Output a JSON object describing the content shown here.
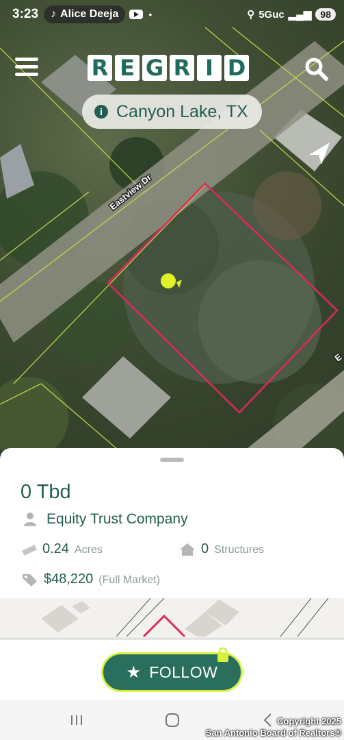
{
  "status_bar": {
    "time": "3:23",
    "notification": "Alice Deeja",
    "network": "5Guc",
    "battery": "98"
  },
  "header": {
    "logo_letters": [
      "R",
      "E",
      "G",
      "R",
      "I",
      "D"
    ]
  },
  "location": {
    "label": "Canyon Lake, TX"
  },
  "map": {
    "street_label": "Eastview Dr",
    "street_label_2": "E"
  },
  "parcel": {
    "title": "0 Tbd",
    "owner": "Equity Trust Company",
    "acres_value": "0.24",
    "acres_unit": "Acres",
    "structures_value": "0",
    "structures_unit": "Structures",
    "price_value": "$48,220",
    "price_note": "(Full Market)"
  },
  "follow": {
    "label": "FOLLOW"
  },
  "copyright": {
    "line1": "Copyright 2025",
    "line2": "San Antonio Board of Realtors®"
  },
  "colors": {
    "brand": "#245e52",
    "accent": "#d7f040",
    "parcel_outline": "#e0285a"
  }
}
